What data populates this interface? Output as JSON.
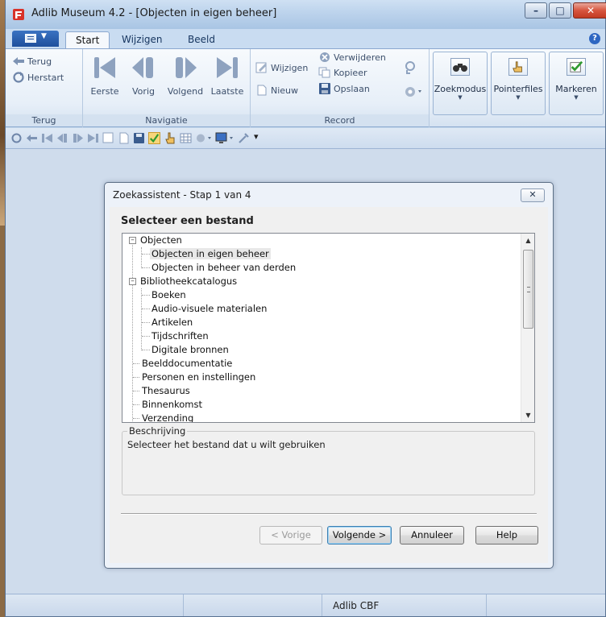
{
  "window": {
    "title": "Adlib Museum 4.2 - [Objecten in eigen beheer]",
    "buttons": {
      "minimize": "–",
      "maximize": "□",
      "close": "✕"
    }
  },
  "ribbon_tabs": [
    "Start",
    "Wijzigen",
    "Beeld"
  ],
  "ribbon": {
    "terug_group": {
      "label": "Terug",
      "terug": "Terug",
      "herstart": "Herstart"
    },
    "navigatie_group": {
      "label": "Navigatie",
      "eerste": "Eerste",
      "vorig": "Vorig",
      "volgend": "Volgend",
      "laatste": "Laatste"
    },
    "record_group": {
      "label": "Record",
      "wijzigen": "Wijzigen",
      "nieuw": "Nieuw",
      "verwijderen": "Verwijderen",
      "kopieer": "Kopieer",
      "opslaan": "Opslaan"
    },
    "zoekmodus": "Zoekmodus",
    "pointerfiles": "Pointerfiles",
    "markeren": "Markeren"
  },
  "statusbar": {
    "text": "Adlib CBF"
  },
  "dialog": {
    "title": "Zoekassistent - Stap 1 van 4",
    "heading": "Selecteer een bestand",
    "tree": [
      {
        "label": "Objecten",
        "level": 0,
        "expanded": true
      },
      {
        "label": "Objecten in eigen beheer",
        "level": 1,
        "selected": true
      },
      {
        "label": "Objecten in beheer van derden",
        "level": 1
      },
      {
        "label": "Bibliotheekcatalogus",
        "level": 0,
        "expanded": true
      },
      {
        "label": "Boeken",
        "level": 1
      },
      {
        "label": "Audio-visuele materialen",
        "level": 1
      },
      {
        "label": "Artikelen",
        "level": 1
      },
      {
        "label": "Tijdschriften",
        "level": 1
      },
      {
        "label": "Digitale bronnen",
        "level": 1
      },
      {
        "label": "Beelddocumentatie",
        "level": 0
      },
      {
        "label": "Personen en instellingen",
        "level": 0
      },
      {
        "label": "Thesaurus",
        "level": 0
      },
      {
        "label": "Binnenkomst",
        "level": 0
      },
      {
        "label": "Verzending",
        "level": 0
      }
    ],
    "description_label": "Beschrijving",
    "description_text": "Selecteer het bestand dat u wilt gebruiken",
    "buttons": {
      "prev": "< Vorige",
      "next": "Volgende >",
      "cancel": "Annuleer",
      "help": "Help"
    }
  }
}
